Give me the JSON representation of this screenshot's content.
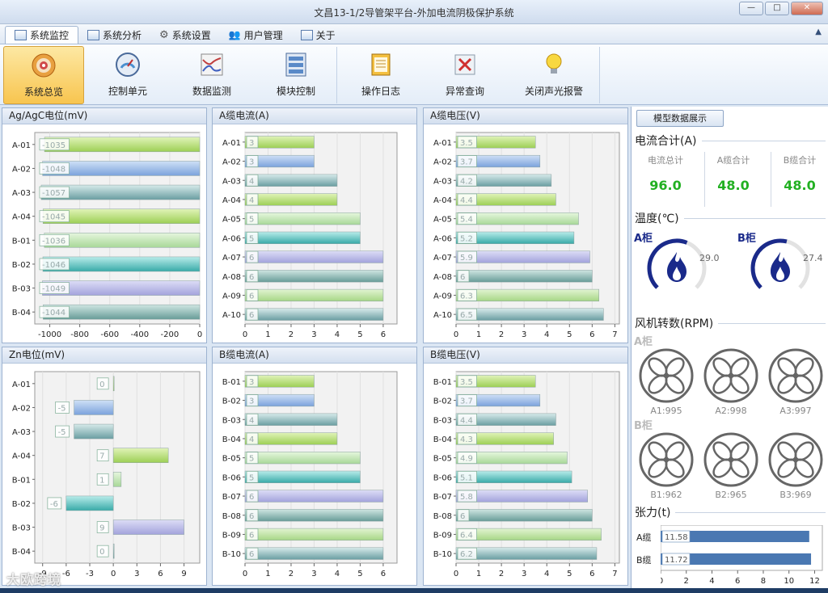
{
  "window": {
    "title": "文昌13-1/2导管架平台-外加电流阴极保护系统",
    "min": "—",
    "max": "□",
    "close": "✕"
  },
  "menu": {
    "tabs": [
      "系统监控",
      "系统分析",
      "系统设置",
      "用户管理",
      "关于"
    ],
    "active": 0,
    "collapse": "▲"
  },
  "toolbar": {
    "buttons": [
      {
        "label": "系统总览",
        "icon": "target-icon"
      },
      {
        "label": "控制单元",
        "icon": "gauge-icon"
      },
      {
        "label": "数据监测",
        "icon": "chart-icon"
      },
      {
        "label": "模块控制",
        "icon": "module-icon"
      },
      {
        "label": "操作日志",
        "icon": "notebook-icon"
      },
      {
        "label": "异常查询",
        "icon": "error-icon"
      },
      {
        "label": "关闭声光报警",
        "icon": "bulb-icon"
      }
    ],
    "active": 0
  },
  "panels": [
    {
      "title": "Ag/AgC电位(mV)"
    },
    {
      "title": "A缆电流(A)"
    },
    {
      "title": "A缆电压(V)"
    },
    {
      "title": "Zn电位(mV)"
    },
    {
      "title": "B缆电流(A)"
    },
    {
      "title": "B缆电压(V)"
    }
  ],
  "chart_data": [
    {
      "type": "bar",
      "orientation": "horizontal",
      "title": "Ag/AgC电位(mV)",
      "categories": [
        "A-01",
        "A-02",
        "A-03",
        "A-04",
        "B-01",
        "B-02",
        "B-03",
        "B-04"
      ],
      "values": [
        -1035,
        -1048,
        -1057,
        -1045,
        -1036,
        -1046,
        -1049,
        -1044
      ],
      "labels": [
        "-1035",
        "-1048",
        "-1057",
        "-1045",
        "-1036",
        "-1046",
        "-1049",
        "-1044"
      ],
      "xlim": [
        -1100,
        0
      ],
      "ticks": [
        -1000,
        -800,
        -600,
        -400,
        -200,
        0
      ]
    },
    {
      "type": "bar",
      "orientation": "horizontal",
      "title": "A缆电流(A)",
      "categories": [
        "A-01",
        "A-02",
        "A-03",
        "A-04",
        "A-05",
        "A-06",
        "A-07",
        "A-08",
        "A-09",
        "A-10"
      ],
      "values": [
        3,
        3,
        4,
        4,
        5,
        5,
        6,
        6,
        6,
        6
      ],
      "labels": [
        "3",
        "3",
        "4",
        "4",
        "5",
        "5",
        "6",
        "6",
        "6",
        "6"
      ],
      "xlim": [
        0,
        6.6
      ],
      "ticks": [
        0,
        1,
        2,
        3,
        4,
        5,
        6
      ]
    },
    {
      "type": "bar",
      "orientation": "horizontal",
      "title": "A缆电压(V)",
      "categories": [
        "A-01",
        "A-02",
        "A-03",
        "A-04",
        "A-05",
        "A-06",
        "A-07",
        "A-08",
        "A-09",
        "A-10"
      ],
      "values": [
        3.5,
        3.7,
        4.2,
        4.4,
        5.4,
        5.2,
        5.9,
        6,
        6.3,
        6.5
      ],
      "labels": [
        "3.5",
        "3.7",
        "4.2",
        "4.4",
        "5.4",
        "5.2",
        "5.9",
        "6",
        "6.3",
        "6.5"
      ],
      "xlim": [
        0,
        7.2
      ],
      "ticks": [
        0,
        1,
        2,
        3,
        4,
        5,
        6,
        7
      ]
    },
    {
      "type": "bar",
      "orientation": "horizontal",
      "title": "Zn电位(mV)",
      "categories": [
        "A-01",
        "A-02",
        "A-03",
        "A-04",
        "B-01",
        "B-02",
        "B-03",
        "B-04"
      ],
      "values": [
        0,
        -5,
        -5,
        7,
        1,
        -6,
        9,
        0
      ],
      "labels": [
        "0",
        "-5",
        "-5",
        "7",
        "1",
        "-6",
        "9",
        "0"
      ],
      "xlim": [
        -10,
        11
      ],
      "ticks": [
        -9,
        -6,
        -3,
        0,
        3,
        6,
        9
      ]
    },
    {
      "type": "bar",
      "orientation": "horizontal",
      "title": "B缆电流(A)",
      "categories": [
        "B-01",
        "B-02",
        "B-03",
        "B-04",
        "B-05",
        "B-06",
        "B-07",
        "B-08",
        "B-09",
        "B-10"
      ],
      "values": [
        3,
        3,
        4,
        4,
        5,
        5,
        6,
        6,
        6,
        6
      ],
      "labels": [
        "3",
        "3",
        "4",
        "4",
        "5",
        "5",
        "6",
        "6",
        "6",
        "6"
      ],
      "xlim": [
        0,
        6.6
      ],
      "ticks": [
        0,
        1,
        2,
        3,
        4,
        5,
        6
      ]
    },
    {
      "type": "bar",
      "orientation": "horizontal",
      "title": "B缆电压(V)",
      "categories": [
        "B-01",
        "B-02",
        "B-03",
        "B-04",
        "B-05",
        "B-06",
        "B-07",
        "B-08",
        "B-09",
        "B-10"
      ],
      "values": [
        3.5,
        3.7,
        4.4,
        4.3,
        4.9,
        5.1,
        5.8,
        6,
        6.4,
        6.2
      ],
      "labels": [
        "3.5",
        "3.7",
        "4.4",
        "4.3",
        "4.9",
        "5.1",
        "5.8",
        "6",
        "6.4",
        "6.2"
      ],
      "xlim": [
        0,
        7.2
      ],
      "ticks": [
        0,
        1,
        2,
        3,
        4,
        5,
        6,
        7
      ]
    },
    {
      "type": "bar",
      "orientation": "horizontal",
      "title": "张力(t)",
      "categories": [
        "A缆",
        "B缆"
      ],
      "values": [
        11.58,
        11.72
      ],
      "labels": [
        "11.58",
        "11.72"
      ],
      "xlim": [
        0,
        12.6
      ],
      "ticks": [
        0,
        2,
        4,
        6,
        8,
        10,
        12
      ]
    }
  ],
  "right": {
    "model_button": "模型数据展示",
    "current_title": "电流合计(A)",
    "current": [
      {
        "label": "电流总计",
        "value": "96.0"
      },
      {
        "label": "A缆合计",
        "value": "48.0"
      },
      {
        "label": "B缆合计",
        "value": "48.0"
      }
    ],
    "temp_title": "温度(℃)",
    "temps": [
      {
        "label": "A柜",
        "value": "29.0",
        "fraction": 0.58
      },
      {
        "label": "B柜",
        "value": "27.4",
        "fraction": 0.55
      }
    ],
    "fan_title": "风机转数(RPM)",
    "fan_groups": [
      "A柜",
      "B柜"
    ],
    "fans": [
      "A1:995",
      "A2:998",
      "A3:997",
      "B1:962",
      "B2:965",
      "B3:969"
    ],
    "tension_title": "张力(t)"
  },
  "watermark": "大欧跨境",
  "colors": {
    "accent": "#1a2a8a",
    "green": "#22b022",
    "tension_bar": "#4a78b2"
  }
}
